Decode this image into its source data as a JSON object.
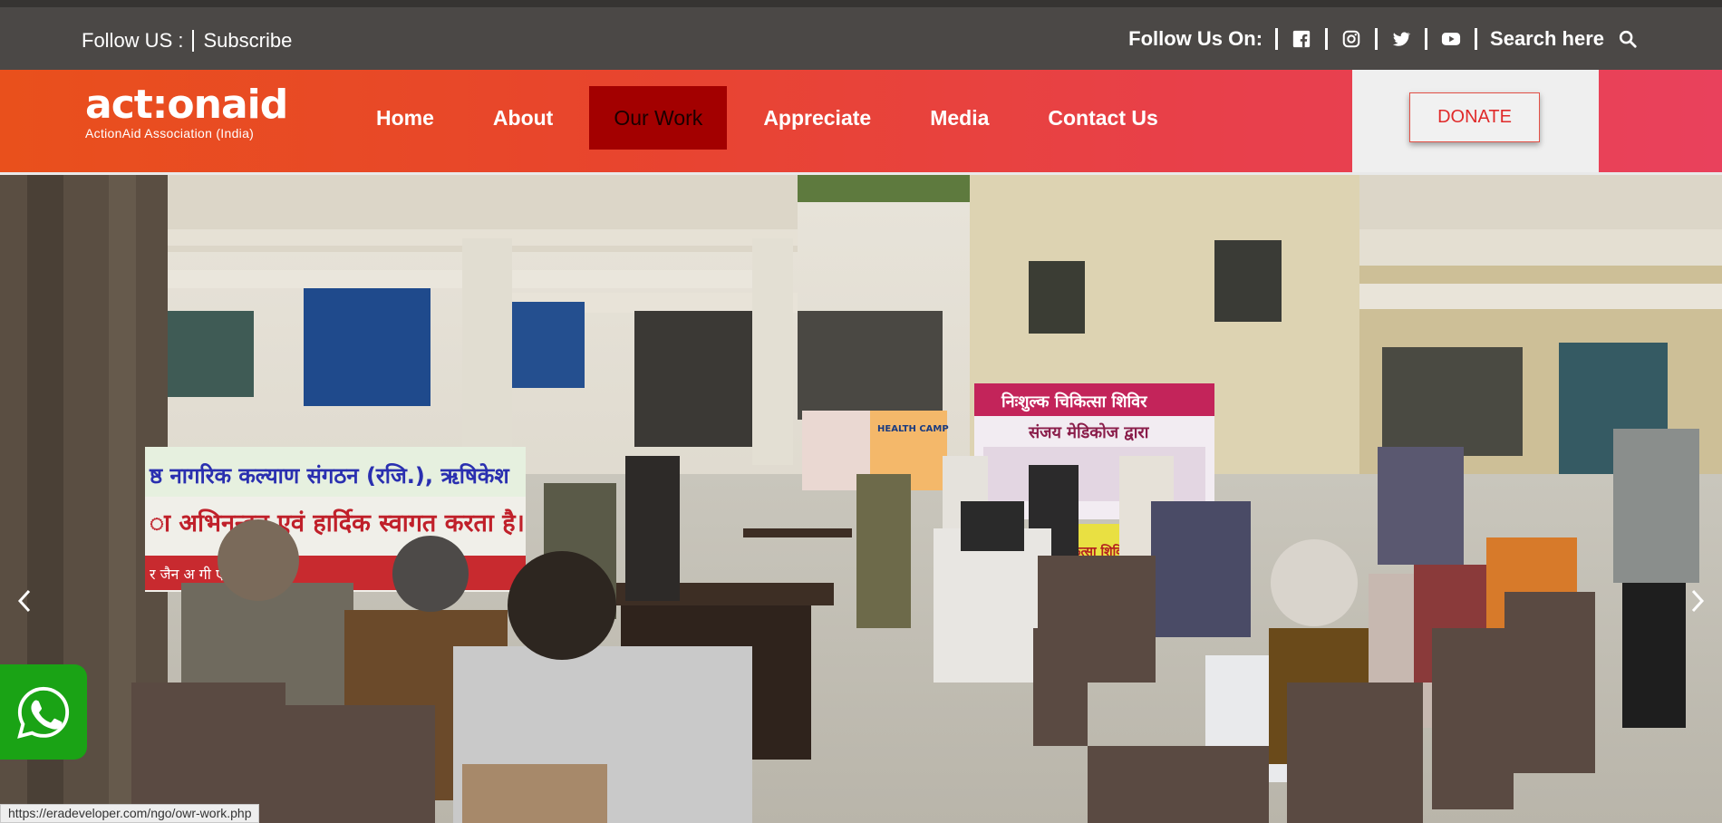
{
  "topbar": {
    "follow_label": "Follow US :",
    "subscribe_label": "Subscribe",
    "follow_on_label": "Follow Us On:",
    "search_label": "Search here"
  },
  "brand": {
    "logo_text": "act:onaid",
    "tagline": "ActionAid Association (India)"
  },
  "nav": {
    "items": [
      {
        "label": "Home"
      },
      {
        "label": "About"
      },
      {
        "label": "Our Work"
      },
      {
        "label": "Appreciate"
      },
      {
        "label": "Media"
      },
      {
        "label": "Contact Us"
      }
    ],
    "active_index": 2,
    "donate_label": "DONATE"
  },
  "hero": {
    "banner_left_line1": "ष्ठ नागरिक कल्याण संगठन (रजि.), ऋषिकेश",
    "banner_left_line2": "ा अभिनन्दन एवं हार्दिक स्वागत करता है।",
    "banner_left_line3": "र जैन    अ          गी     एस.पी.",
    "banner_right_title": "निःशुल्क चिकित्सा शिविर",
    "banner_right_sub": "संजय मेडिकोज द्वारा",
    "poster_text": "HEALTH CAMP",
    "banner_bottom_text": "कृ चिकित्सा शिविर"
  },
  "status_url": "https://eradeveloper.com/ngo/owr-work.php",
  "colors": {
    "topbar_bg": "#4b4846",
    "nav_start": "#e9501c",
    "nav_end": "#e9415c",
    "active_nav_bg": "#a30000",
    "donate_text": "#e02a2a",
    "whatsapp_green": "#1aa315"
  },
  "icons": [
    "facebook-icon",
    "instagram-icon",
    "twitter-icon",
    "youtube-icon",
    "search-icon",
    "chevron-left-icon",
    "chevron-right-icon",
    "whatsapp-icon"
  ]
}
